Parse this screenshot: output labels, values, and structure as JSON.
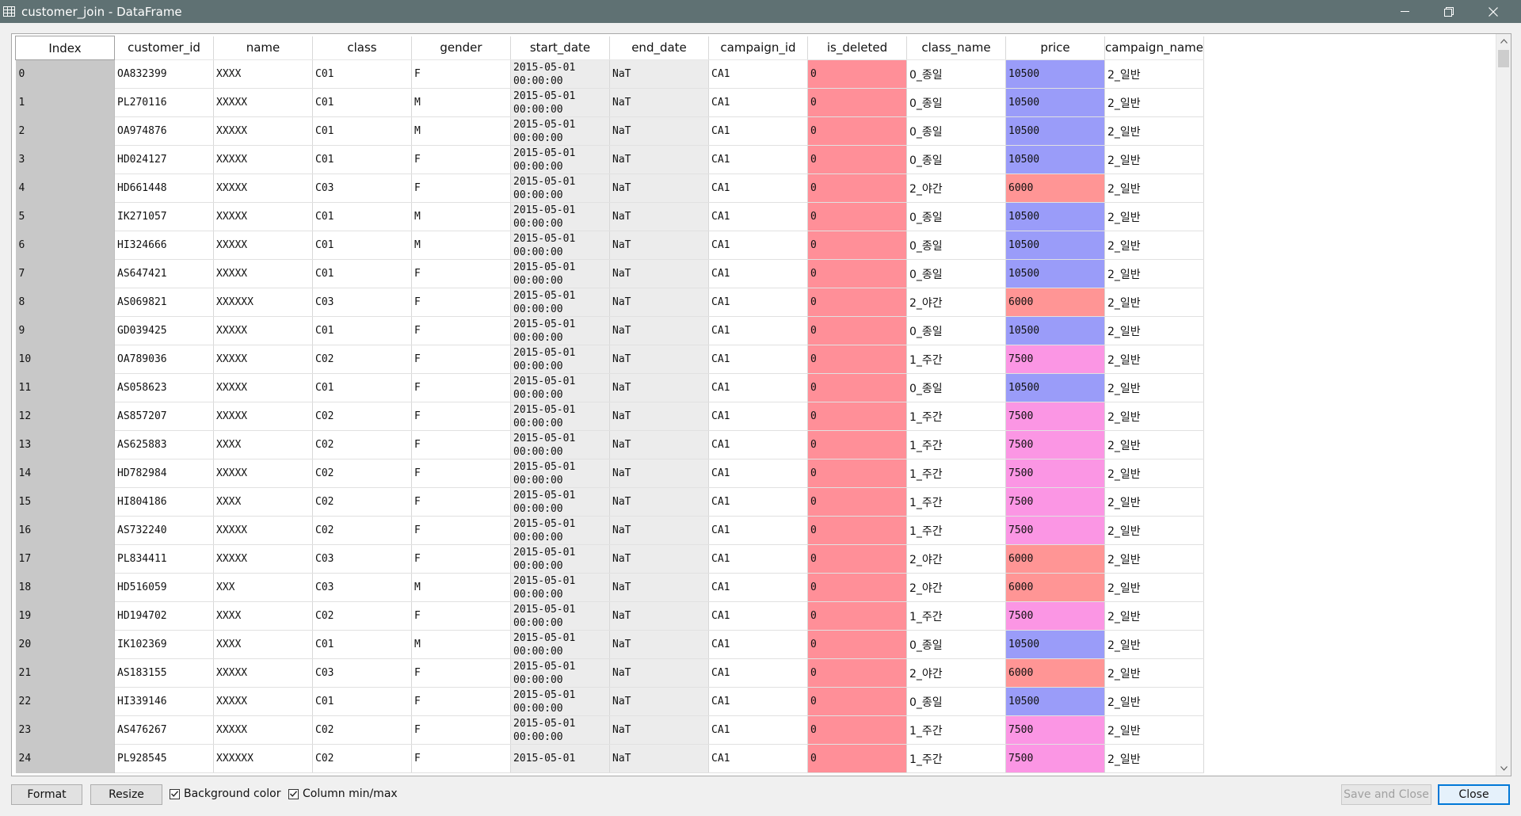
{
  "window": {
    "title": "customer_join - DataFrame"
  },
  "columns": [
    "Index",
    "customer_id",
    "name",
    "class",
    "gender",
    "start_date",
    "end_date",
    "campaign_id",
    "is_deleted",
    "class_name",
    "price",
    "campaign_name"
  ],
  "rows": [
    {
      "index": "0",
      "customer_id": "OA832399",
      "name": "XXXX",
      "class": "C01",
      "gender": "F",
      "start_date": "2015-05-01\n00:00:00",
      "end_date": "NaT",
      "campaign_id": "CA1",
      "is_deleted": "0",
      "class_name": "0_종일",
      "price": "10500",
      "campaign_name": "2_일반"
    },
    {
      "index": "1",
      "customer_id": "PL270116",
      "name": "XXXXX",
      "class": "C01",
      "gender": "M",
      "start_date": "2015-05-01\n00:00:00",
      "end_date": "NaT",
      "campaign_id": "CA1",
      "is_deleted": "0",
      "class_name": "0_종일",
      "price": "10500",
      "campaign_name": "2_일반"
    },
    {
      "index": "2",
      "customer_id": "OA974876",
      "name": "XXXXX",
      "class": "C01",
      "gender": "M",
      "start_date": "2015-05-01\n00:00:00",
      "end_date": "NaT",
      "campaign_id": "CA1",
      "is_deleted": "0",
      "class_name": "0_종일",
      "price": "10500",
      "campaign_name": "2_일반"
    },
    {
      "index": "3",
      "customer_id": "HD024127",
      "name": "XXXXX",
      "class": "C01",
      "gender": "F",
      "start_date": "2015-05-01\n00:00:00",
      "end_date": "NaT",
      "campaign_id": "CA1",
      "is_deleted": "0",
      "class_name": "0_종일",
      "price": "10500",
      "campaign_name": "2_일반"
    },
    {
      "index": "4",
      "customer_id": "HD661448",
      "name": "XXXXX",
      "class": "C03",
      "gender": "F",
      "start_date": "2015-05-01\n00:00:00",
      "end_date": "NaT",
      "campaign_id": "CA1",
      "is_deleted": "0",
      "class_name": "2_야간",
      "price": "6000",
      "campaign_name": "2_일반"
    },
    {
      "index": "5",
      "customer_id": "IK271057",
      "name": "XXXXX",
      "class": "C01",
      "gender": "M",
      "start_date": "2015-05-01\n00:00:00",
      "end_date": "NaT",
      "campaign_id": "CA1",
      "is_deleted": "0",
      "class_name": "0_종일",
      "price": "10500",
      "campaign_name": "2_일반"
    },
    {
      "index": "6",
      "customer_id": "HI324666",
      "name": "XXXXX",
      "class": "C01",
      "gender": "M",
      "start_date": "2015-05-01\n00:00:00",
      "end_date": "NaT",
      "campaign_id": "CA1",
      "is_deleted": "0",
      "class_name": "0_종일",
      "price": "10500",
      "campaign_name": "2_일반"
    },
    {
      "index": "7",
      "customer_id": "AS647421",
      "name": "XXXXX",
      "class": "C01",
      "gender": "F",
      "start_date": "2015-05-01\n00:00:00",
      "end_date": "NaT",
      "campaign_id": "CA1",
      "is_deleted": "0",
      "class_name": "0_종일",
      "price": "10500",
      "campaign_name": "2_일반"
    },
    {
      "index": "8",
      "customer_id": "AS069821",
      "name": "XXXXXX",
      "class": "C03",
      "gender": "F",
      "start_date": "2015-05-01\n00:00:00",
      "end_date": "NaT",
      "campaign_id": "CA1",
      "is_deleted": "0",
      "class_name": "2_야간",
      "price": "6000",
      "campaign_name": "2_일반"
    },
    {
      "index": "9",
      "customer_id": "GD039425",
      "name": "XXXXX",
      "class": "C01",
      "gender": "F",
      "start_date": "2015-05-01\n00:00:00",
      "end_date": "NaT",
      "campaign_id": "CA1",
      "is_deleted": "0",
      "class_name": "0_종일",
      "price": "10500",
      "campaign_name": "2_일반"
    },
    {
      "index": "10",
      "customer_id": "OA789036",
      "name": "XXXXX",
      "class": "C02",
      "gender": "F",
      "start_date": "2015-05-01\n00:00:00",
      "end_date": "NaT",
      "campaign_id": "CA1",
      "is_deleted": "0",
      "class_name": "1_주간",
      "price": "7500",
      "campaign_name": "2_일반"
    },
    {
      "index": "11",
      "customer_id": "AS058623",
      "name": "XXXXX",
      "class": "C01",
      "gender": "F",
      "start_date": "2015-05-01\n00:00:00",
      "end_date": "NaT",
      "campaign_id": "CA1",
      "is_deleted": "0",
      "class_name": "0_종일",
      "price": "10500",
      "campaign_name": "2_일반"
    },
    {
      "index": "12",
      "customer_id": "AS857207",
      "name": "XXXXX",
      "class": "C02",
      "gender": "F",
      "start_date": "2015-05-01\n00:00:00",
      "end_date": "NaT",
      "campaign_id": "CA1",
      "is_deleted": "0",
      "class_name": "1_주간",
      "price": "7500",
      "campaign_name": "2_일반"
    },
    {
      "index": "13",
      "customer_id": "AS625883",
      "name": "XXXX",
      "class": "C02",
      "gender": "F",
      "start_date": "2015-05-01\n00:00:00",
      "end_date": "NaT",
      "campaign_id": "CA1",
      "is_deleted": "0",
      "class_name": "1_주간",
      "price": "7500",
      "campaign_name": "2_일반"
    },
    {
      "index": "14",
      "customer_id": "HD782984",
      "name": "XXXXX",
      "class": "C02",
      "gender": "F",
      "start_date": "2015-05-01\n00:00:00",
      "end_date": "NaT",
      "campaign_id": "CA1",
      "is_deleted": "0",
      "class_name": "1_주간",
      "price": "7500",
      "campaign_name": "2_일반"
    },
    {
      "index": "15",
      "customer_id": "HI804186",
      "name": "XXXX",
      "class": "C02",
      "gender": "F",
      "start_date": "2015-05-01\n00:00:00",
      "end_date": "NaT",
      "campaign_id": "CA1",
      "is_deleted": "0",
      "class_name": "1_주간",
      "price": "7500",
      "campaign_name": "2_일반"
    },
    {
      "index": "16",
      "customer_id": "AS732240",
      "name": "XXXXX",
      "class": "C02",
      "gender": "F",
      "start_date": "2015-05-01\n00:00:00",
      "end_date": "NaT",
      "campaign_id": "CA1",
      "is_deleted": "0",
      "class_name": "1_주간",
      "price": "7500",
      "campaign_name": "2_일반"
    },
    {
      "index": "17",
      "customer_id": "PL834411",
      "name": "XXXXX",
      "class": "C03",
      "gender": "F",
      "start_date": "2015-05-01\n00:00:00",
      "end_date": "NaT",
      "campaign_id": "CA1",
      "is_deleted": "0",
      "class_name": "2_야간",
      "price": "6000",
      "campaign_name": "2_일반"
    },
    {
      "index": "18",
      "customer_id": "HD516059",
      "name": "XXX",
      "class": "C03",
      "gender": "M",
      "start_date": "2015-05-01\n00:00:00",
      "end_date": "NaT",
      "campaign_id": "CA1",
      "is_deleted": "0",
      "class_name": "2_야간",
      "price": "6000",
      "campaign_name": "2_일반"
    },
    {
      "index": "19",
      "customer_id": "HD194702",
      "name": "XXXX",
      "class": "C02",
      "gender": "F",
      "start_date": "2015-05-01\n00:00:00",
      "end_date": "NaT",
      "campaign_id": "CA1",
      "is_deleted": "0",
      "class_name": "1_주간",
      "price": "7500",
      "campaign_name": "2_일반"
    },
    {
      "index": "20",
      "customer_id": "IK102369",
      "name": "XXXX",
      "class": "C01",
      "gender": "M",
      "start_date": "2015-05-01\n00:00:00",
      "end_date": "NaT",
      "campaign_id": "CA1",
      "is_deleted": "0",
      "class_name": "0_종일",
      "price": "10500",
      "campaign_name": "2_일반"
    },
    {
      "index": "21",
      "customer_id": "AS183155",
      "name": "XXXXX",
      "class": "C03",
      "gender": "F",
      "start_date": "2015-05-01\n00:00:00",
      "end_date": "NaT",
      "campaign_id": "CA1",
      "is_deleted": "0",
      "class_name": "2_야간",
      "price": "6000",
      "campaign_name": "2_일반"
    },
    {
      "index": "22",
      "customer_id": "HI339146",
      "name": "XXXXX",
      "class": "C01",
      "gender": "F",
      "start_date": "2015-05-01\n00:00:00",
      "end_date": "NaT",
      "campaign_id": "CA1",
      "is_deleted": "0",
      "class_name": "0_종일",
      "price": "10500",
      "campaign_name": "2_일반"
    },
    {
      "index": "23",
      "customer_id": "AS476267",
      "name": "XXXXX",
      "class": "C02",
      "gender": "F",
      "start_date": "2015-05-01\n00:00:00",
      "end_date": "NaT",
      "campaign_id": "CA1",
      "is_deleted": "0",
      "class_name": "1_주간",
      "price": "7500",
      "campaign_name": "2_일반"
    },
    {
      "index": "24",
      "customer_id": "PL928545",
      "name": "XXXXXX",
      "class": "C02",
      "gender": "F",
      "start_date": "2015-05-01",
      "end_date": "NaT",
      "campaign_id": "CA1",
      "is_deleted": "0",
      "class_name": "1_주간",
      "price": "7500",
      "campaign_name": "2_일반"
    }
  ],
  "colors": {
    "is_deleted": "#ff8f98",
    "price_10500": "#9a9cf9",
    "price_6000": "#ff9595",
    "price_7500": "#fb96e4",
    "index_column": "#c8c8c8",
    "date_columns": "#ececec",
    "titlebar": "#5f7173"
  },
  "footer": {
    "format_label": "Format",
    "resize_label": "Resize",
    "bgcolor_label": "Background color",
    "bgcolor_checked": true,
    "minmax_label": "Column min/max",
    "minmax_checked": true,
    "save_close_label": "Save and Close",
    "close_label": "Close"
  }
}
